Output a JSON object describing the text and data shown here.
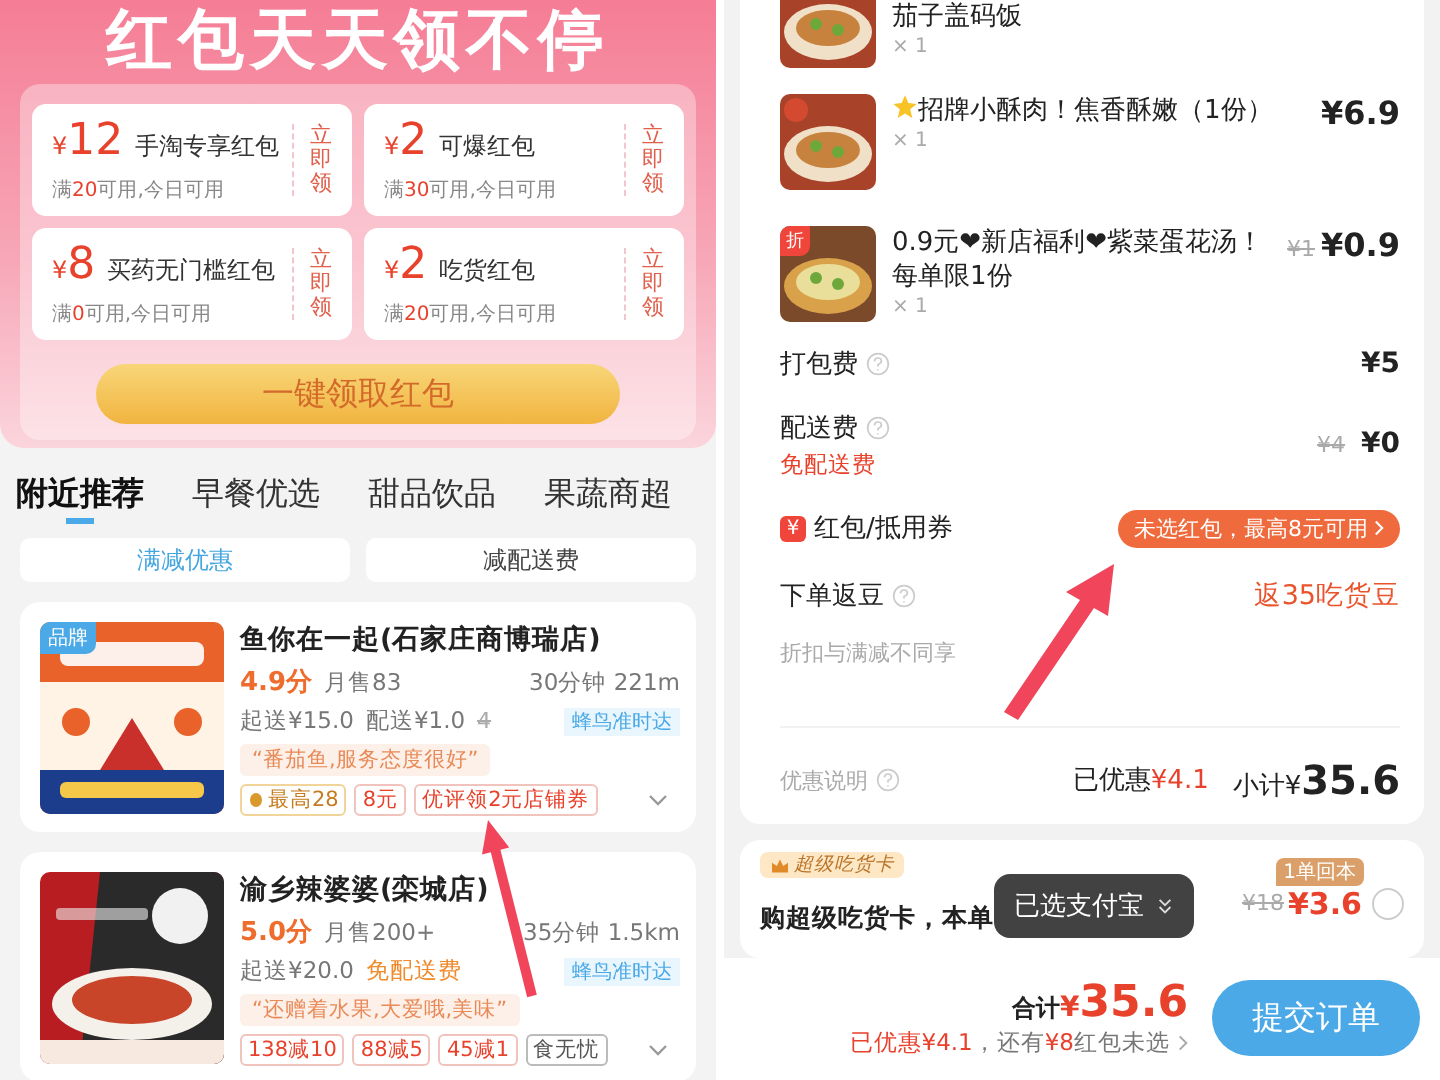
{
  "banner": {
    "title": "红包天天领不停",
    "claim_button": "一键领取红包",
    "coupons": [
      {
        "currency": "¥",
        "amount": "12",
        "name": "手淘专享红包",
        "prefix": "满",
        "min": "20",
        "suffix": "可用,今日可用",
        "action": "立即领"
      },
      {
        "currency": "¥",
        "amount": "2",
        "name": "可爆红包",
        "prefix": "满",
        "min": "30",
        "suffix": "可用,今日可用",
        "action": "立即领"
      },
      {
        "currency": "¥",
        "amount": "8",
        "name": "买药无门槛红包",
        "prefix": "满",
        "min": "0",
        "suffix": "可用,今日可用",
        "action": "立即领"
      },
      {
        "currency": "¥",
        "amount": "2",
        "name": "吃货红包",
        "prefix": "满",
        "min": "20",
        "suffix": "可用,今日可用",
        "action": "立即领"
      }
    ]
  },
  "tabs": [
    {
      "label": "附近推荐",
      "selected": true
    },
    {
      "label": "早餐优选",
      "selected": false
    },
    {
      "label": "甜品饮品",
      "selected": false
    },
    {
      "label": "果蔬商超",
      "selected": false
    }
  ],
  "filters": [
    {
      "label": "满减优惠",
      "selected": true
    },
    {
      "label": "减配送费",
      "selected": false
    }
  ],
  "stores": [
    {
      "badge": "品牌",
      "name": "鱼你在一起(石家庄商博瑞店)",
      "rating": "4.9分",
      "sales": "月售83",
      "eta": "30分钟 221m",
      "min_order": "起送¥15.0",
      "delivery": "配送¥1.0",
      "delivery_old": "4",
      "free": false,
      "delivery_tag": "蜂鸟准时达",
      "review": "“番茄鱼,服务态度很好”",
      "tags": [
        {
          "text": "最高28",
          "kind": "bean"
        },
        {
          "text": "8元",
          "kind": "red"
        },
        {
          "text": "优评领2元店铺券",
          "kind": "red"
        }
      ]
    },
    {
      "name": "渝乡辣婆婆(栾城店)",
      "rating": "5.0分",
      "sales": "月售200+",
      "eta": "35分钟 1.5km",
      "min_order": "起送¥20.0",
      "delivery": "免配送费",
      "free": true,
      "delivery_tag": "蜂鸟准时达",
      "review": "“还赠着水果,大爱哦,美味”",
      "tags": [
        {
          "text": "138减10",
          "kind": "red"
        },
        {
          "text": "88减5",
          "kind": "red"
        },
        {
          "text": "45减1",
          "kind": "red"
        },
        {
          "text": "食无忧",
          "kind": "grey"
        }
      ]
    }
  ],
  "order": {
    "items": [
      {
        "kind": "plain",
        "name": "茄子盖码饭",
        "qty": "× 1"
      },
      {
        "kind": "starred",
        "name": "招牌小酥肉！焦香酥嫩（1份）",
        "price": "¥6.9",
        "qty": "× 1"
      },
      {
        "kind": "plain",
        "badge": "折",
        "name": "0.9元❤新店福利❤紫菜蛋花汤！每单限1份",
        "old_price": "¥1",
        "price": "¥0.9",
        "qty": "× 1"
      }
    ],
    "packing": {
      "label": "打包费",
      "value": "¥5"
    },
    "delivery": {
      "label": "配送费",
      "note": "免配送费",
      "old": "¥4",
      "value": "¥0"
    },
    "coupon": {
      "icon": "¥",
      "label": "红包/抵用券",
      "pill": "未选红包，最高8元可用"
    },
    "beans": {
      "label": "下单返豆",
      "value": "返35吃货豆"
    },
    "note": "折扣与满减不同享",
    "summary": {
      "label": "优惠说明",
      "discount_label": "已优惠",
      "discount": "¥4.1",
      "subtotal_label": "小计¥",
      "subtotal": "35.6"
    }
  },
  "card": {
    "badge": "超级吃货卡",
    "tag": "1单回本",
    "text": "购超级吃货卡，本单",
    "old_price": "¥18",
    "price": "¥3.6",
    "checked": false
  },
  "toast": "已选支付宝",
  "footer": {
    "total_label": "合计",
    "currency": "¥",
    "total": "35.6",
    "savings": [
      {
        "text": "已优惠¥4.1",
        "hl": true
      },
      {
        "text": "，还有",
        "hl": false
      },
      {
        "text": "¥8",
        "hl": true
      },
      {
        "text": "红包未选",
        "hl": false
      }
    ],
    "submit": "提交订单"
  }
}
